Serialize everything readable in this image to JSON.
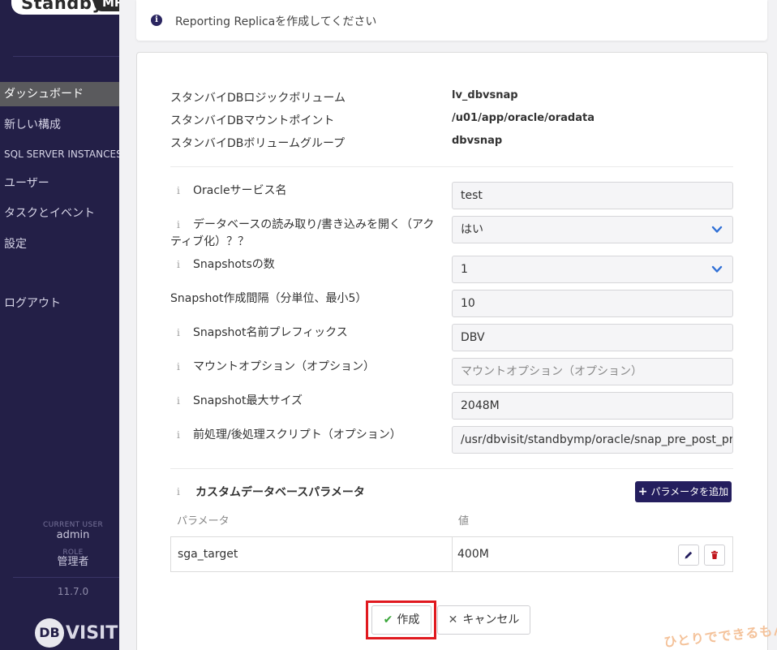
{
  "sidebar": {
    "logo_text": "Standby",
    "logo_pill": "MP",
    "nav": [
      {
        "label": "ダッシュボード",
        "active": true
      },
      {
        "label": "新しい構成"
      },
      {
        "label": "SQL SERVER INSTANCES"
      },
      {
        "label": "ユーザー"
      },
      {
        "label": "タスクとイベント"
      },
      {
        "label": "設定"
      },
      {
        "label": "ログアウト"
      }
    ],
    "current_user_label": "CURRENT USER",
    "current_user": "admin",
    "role_label": "ROLE",
    "role": "管理者",
    "version": "11.7.0",
    "brand_circle": "DB",
    "brand_text": "VISIT"
  },
  "banner": {
    "icon": "i",
    "text": "Reporting Replicaを作成してください"
  },
  "info": {
    "rows": [
      {
        "label": "スタンバイDBロジックボリューム",
        "value": "lv_dbvsnap"
      },
      {
        "label": "スタンバイDBマウントポイント",
        "value": "/u01/app/oracle/oradata"
      },
      {
        "label": "スタンバイDBボリュームグループ",
        "value": "dbvsnap"
      }
    ]
  },
  "form": {
    "info_glyph": "i",
    "service_name": {
      "label": "Oracleサービス名",
      "value": "test"
    },
    "open_rw": {
      "label_line1": "データベースの読み取り/書き込みを開く（アク",
      "label_line2": "ティブ化）？？",
      "value": "はい"
    },
    "snapshot_count": {
      "label": "Snapshotsの数",
      "value": "1"
    },
    "snapshot_interval": {
      "label": "Snapshot作成間隔（分単位、最小5）",
      "value": "10"
    },
    "snapshot_prefix": {
      "label": "Snapshot名前プレフィックス",
      "value": "DBV"
    },
    "mount_options": {
      "label": "マウントオプション（オプション）",
      "placeholder": "マウントオプション（オプション）"
    },
    "snapshot_max_size": {
      "label": "Snapshot最大サイズ",
      "value": "2048M"
    },
    "script": {
      "label": "前処理/後処理スクリプト（オプション）",
      "value": "/usr/dbvisit/standbymp/oracle/snap_pre_post_proc.sh"
    }
  },
  "custom_params": {
    "title": "カスタムデータベースパラメータ",
    "add_button": "パラメータを追加",
    "col_param": "パラメータ",
    "col_value": "値",
    "rows": [
      {
        "param": "sga_target",
        "value": "400M"
      }
    ]
  },
  "actions": {
    "create": "作成",
    "cancel": "キャンセル"
  },
  "watermark": "ひとりでできるもん",
  "colors": {
    "sidebar_bg": "#231f47",
    "primary": "#241e5e",
    "highlight": "#e0191f",
    "check": "#3aa63a",
    "delete": "#c0141a"
  }
}
